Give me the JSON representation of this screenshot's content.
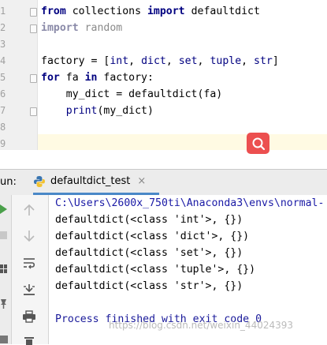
{
  "editor": {
    "line_numbers": [
      "1",
      "2",
      "3",
      "4",
      "5",
      "6",
      "7",
      "8",
      "9"
    ],
    "code": {
      "l1": {
        "kw1": "from",
        "mid": " collections ",
        "kw2": "import",
        "rest": " defaultdict"
      },
      "l2": {
        "kw": "import",
        "rest": " random"
      },
      "l4": {
        "pre": "factory = [",
        "t1": "int",
        "s1": ", ",
        "t2": "dict",
        "s2": ", ",
        "t3": "set",
        "s3": ", ",
        "t4": "tuple",
        "s4": ", ",
        "t5": "str",
        "post": "]"
      },
      "l5": {
        "kw1": "for",
        "mid": " fa ",
        "kw2": "in",
        "rest": " factory:"
      },
      "l6": {
        "text": "    my_dict = defaultdict(fa)"
      },
      "l7": {
        "indent": "    ",
        "fn": "print",
        "rest": "(my_dict)"
      }
    }
  },
  "run_panel": {
    "label": "un:",
    "tab_title": "defaultdict_test",
    "tab_close": "×"
  },
  "console": {
    "command": "C:\\Users\\2600x_750ti\\Anaconda3\\envs\\normal-",
    "output": [
      "defaultdict(<class 'int'>, {})",
      "defaultdict(<class 'dict'>, {})",
      "defaultdict(<class 'set'>, {})",
      "defaultdict(<class 'tuple'>, {})",
      "defaultdict(<class 'str'>, {})"
    ],
    "exit_message": "Process finished with exit code 0"
  },
  "watermark": "https://blog.csdn.net/weixin_44024393",
  "colors": {
    "keyword": "#000080",
    "console_link": "#1a1aa6",
    "exit_message": "#1a1a9a",
    "search_button": "#ec4f4f",
    "tab_underline": "#4a88c7"
  }
}
